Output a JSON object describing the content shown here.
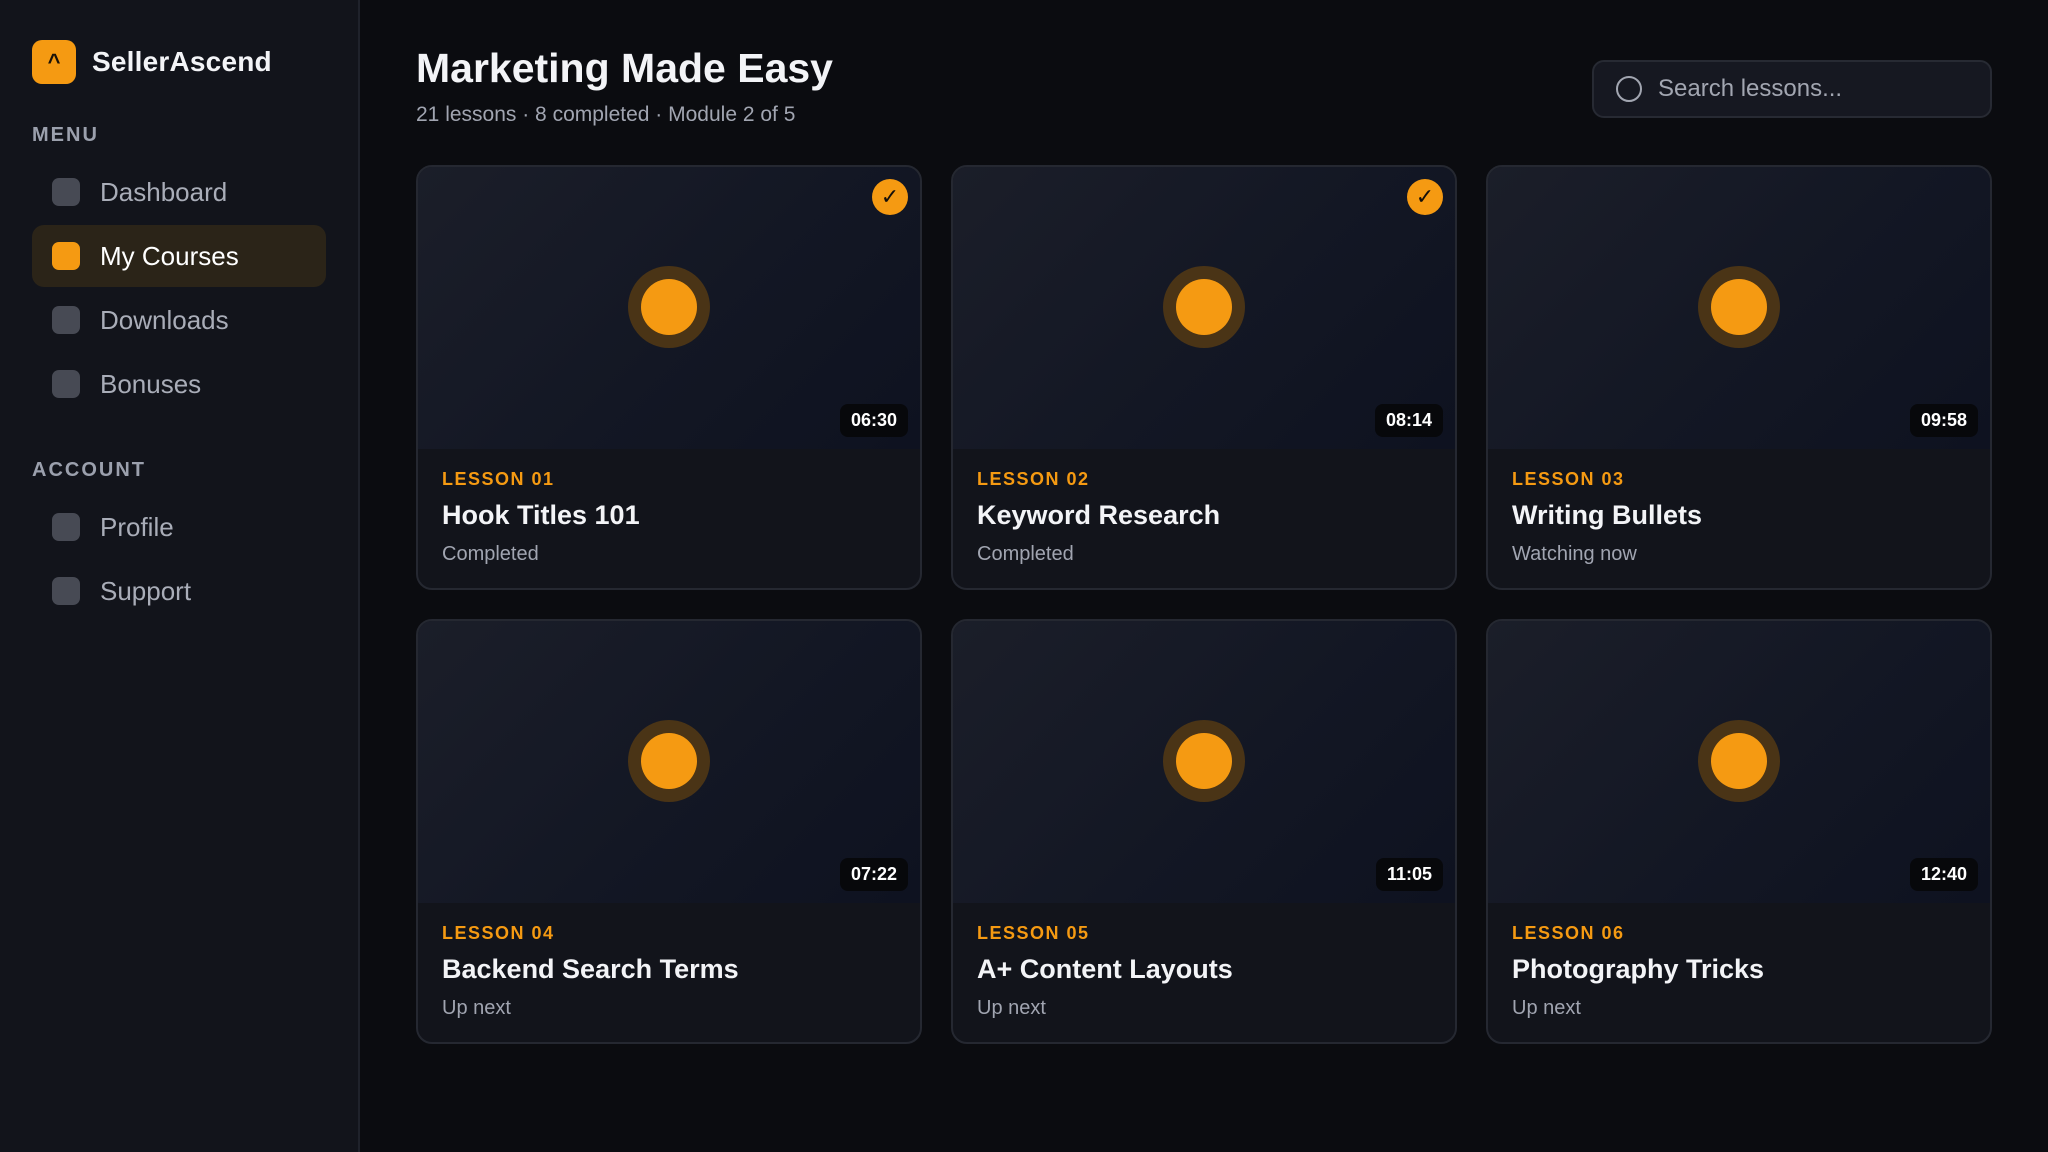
{
  "brand": {
    "logo_glyph": "^",
    "name": "SellerAscend"
  },
  "sidebar": {
    "menu_label": "MENU",
    "menu_items": [
      {
        "label": "Dashboard",
        "active": false
      },
      {
        "label": "My Courses",
        "active": true
      },
      {
        "label": "Downloads",
        "active": false
      },
      {
        "label": "Bonuses",
        "active": false
      }
    ],
    "account_label": "ACCOUNT",
    "account_items": [
      {
        "label": "Profile"
      },
      {
        "label": "Support"
      }
    ]
  },
  "header": {
    "title": "Marketing Made Easy",
    "subtitle": "21 lessons · 8 completed · Module 2 of 5"
  },
  "search": {
    "placeholder": "Search lessons...",
    "icon": "search-icon"
  },
  "lessons": [
    {
      "number": "LESSON 01",
      "title": "Hook Titles 101",
      "status": "Completed",
      "duration": "06:30",
      "completed": true,
      "check": "✓"
    },
    {
      "number": "LESSON 02",
      "title": "Keyword Research",
      "status": "Completed",
      "duration": "08:14",
      "completed": true,
      "check": "✓"
    },
    {
      "number": "LESSON 03",
      "title": "Writing Bullets",
      "status": "Watching now",
      "duration": "09:58",
      "completed": false
    },
    {
      "number": "LESSON 04",
      "title": "Backend Search Terms",
      "status": "Up next",
      "duration": "07:22",
      "completed": false
    },
    {
      "number": "LESSON 05",
      "title": "A+ Content Layouts",
      "status": "Up next",
      "duration": "11:05",
      "completed": false
    },
    {
      "number": "LESSON 06",
      "title": "Photography Tricks",
      "status": "Up next",
      "duration": "12:40",
      "completed": false
    }
  ],
  "colors": {
    "accent": "#f59a12",
    "background": "#0b0c10",
    "sidebar": "#12141b",
    "active_nav": "#2b2418"
  }
}
